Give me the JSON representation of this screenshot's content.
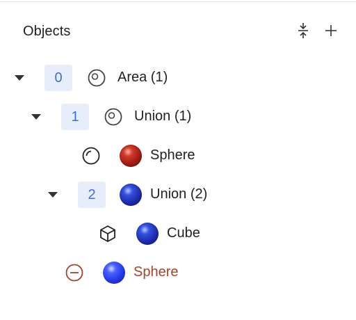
{
  "panel": {
    "title": "Objects",
    "actions": [
      {
        "name": "collapse-all",
        "icon": "collapse-vertical-icon"
      },
      {
        "name": "add",
        "icon": "plus-icon"
      }
    ]
  },
  "tree": [
    {
      "index": "0",
      "type_icon": "area-icon",
      "label": "Area (1)",
      "expanded": true
    },
    {
      "index": "1",
      "type_icon": "union-icon",
      "label": "Union (1)",
      "expanded": true
    },
    {
      "type_icon": "sphere-icon",
      "material": "red",
      "label": "Sphere"
    },
    {
      "index": "2",
      "material": "blue",
      "label": "Union (2)",
      "expanded": true
    },
    {
      "type_icon": "cube-icon",
      "material": "blue",
      "label": "Cube"
    },
    {
      "type_icon": "subtract-icon",
      "material": "blue",
      "label": "Sphere",
      "operation": "subtract"
    }
  ],
  "colors": {
    "accent": "#3b6fd6",
    "badge_bg": "#e8eef9",
    "subtract": "#a0452b"
  }
}
